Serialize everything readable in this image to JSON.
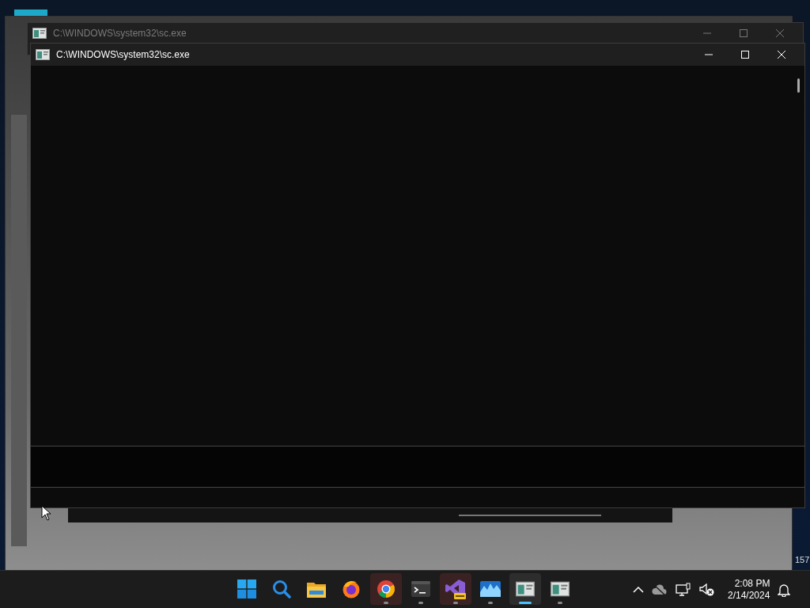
{
  "background_window": {
    "title": "C:\\WINDOWS\\system32\\sc.exe",
    "edge_text": "157"
  },
  "console_window": {
    "title": "C:\\WINDOWS\\system32\\sc.exe"
  },
  "taskbar": {
    "apps": [
      {
        "kind": "start",
        "running": false,
        "selected": false
      },
      {
        "kind": "search",
        "running": false,
        "selected": false
      },
      {
        "kind": "folder",
        "running": false,
        "selected": false
      },
      {
        "kind": "firefox",
        "running": false,
        "selected": false
      },
      {
        "kind": "chrome",
        "running": true,
        "selected": false
      },
      {
        "kind": "terminal",
        "running": true,
        "selected": false
      },
      {
        "kind": "studio",
        "running": true,
        "selected": false
      },
      {
        "kind": "chart",
        "running": true,
        "selected": false
      },
      {
        "kind": "console",
        "running": true,
        "selected": true
      },
      {
        "kind": "console",
        "running": true,
        "selected": false
      }
    ],
    "time": "2:08 PM",
    "date": "2/14/2024"
  }
}
